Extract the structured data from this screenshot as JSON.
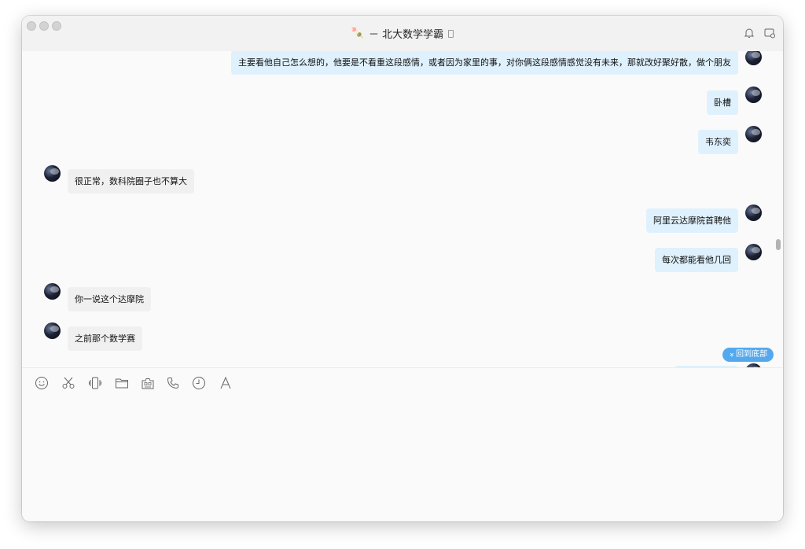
{
  "window": {
    "title_emoji": "🍡",
    "title": "－ 北大数学学霸"
  },
  "messages": [
    {
      "side": "right",
      "text": "主要看他自己怎么想的，他要是不看重这段感情，或者因为家里的事，对你俩这段感情感觉没有未来，那就改好聚好散，做个朋友"
    },
    {
      "side": "right",
      "text": "卧槽"
    },
    {
      "side": "right",
      "text": "韦东奕"
    },
    {
      "side": "left",
      "text": "很正常，数科院圈子也不算大"
    },
    {
      "side": "right",
      "text": "阿里云达摩院首聘他"
    },
    {
      "side": "right",
      "text": "每次都能看他几回"
    },
    {
      "side": "left",
      "text": "你一说这个达摩院"
    },
    {
      "side": "left",
      "text": "之前那个数学赛"
    }
  ],
  "back_to_bottom": {
    "icon": "»",
    "label": "回到底部"
  },
  "toolbar": {
    "icons": [
      "emoji-icon",
      "scissors-icon",
      "shake-icon",
      "folder-icon",
      "screenshot-icon",
      "phone-icon",
      "clock-icon",
      "text-format-icon"
    ]
  },
  "colors": {
    "my_bubble": "#dff1fd",
    "their_bubble": "#f0f0f0",
    "accent": "#54a9ee"
  }
}
